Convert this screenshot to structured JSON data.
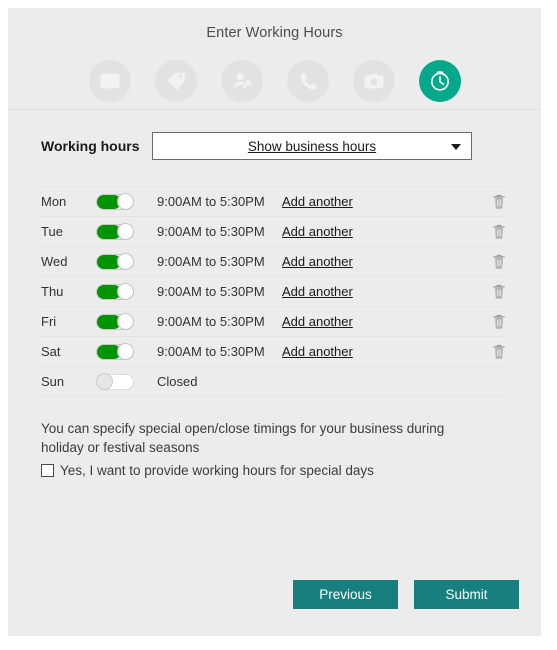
{
  "wizard": {
    "title": "Enter Working Hours",
    "steps": [
      {
        "icon": "id-card-icon",
        "name": "step-business-info",
        "active": false
      },
      {
        "icon": "tag-icon",
        "name": "step-category",
        "active": false
      },
      {
        "icon": "person-add-icon",
        "name": "step-people",
        "active": false
      },
      {
        "icon": "phone-icon",
        "name": "step-contact",
        "active": false
      },
      {
        "icon": "camera-icon",
        "name": "step-photos",
        "active": false
      },
      {
        "icon": "clock-icon",
        "name": "step-working-hours",
        "active": true
      }
    ]
  },
  "working_hours": {
    "label": "Working hours",
    "select_value": "Show business hours",
    "caret": "chevron-down-icon"
  },
  "days": [
    {
      "day": "Mon",
      "enabled": true,
      "toggle_state": "on",
      "hours": "9:00AM to 5:30PM",
      "add_label": "Add another",
      "trash": "trash-icon"
    },
    {
      "day": "Tue",
      "enabled": true,
      "toggle_state": "on",
      "hours": "9:00AM to 5:30PM",
      "add_label": "Add another",
      "trash": "trash-icon"
    },
    {
      "day": "Wed",
      "enabled": true,
      "toggle_state": "on",
      "hours": "9:00AM to 5:30PM",
      "add_label": "Add another",
      "trash": "trash-icon"
    },
    {
      "day": "Thu",
      "enabled": true,
      "toggle_state": "on",
      "hours": "9:00AM to 5:30PM",
      "add_label": "Add another",
      "trash": "trash-icon"
    },
    {
      "day": "Fri",
      "enabled": true,
      "toggle_state": "on",
      "hours": "9:00AM to 5:30PM",
      "add_label": "Add another",
      "trash": "trash-icon"
    },
    {
      "day": "Sat",
      "enabled": true,
      "toggle_state": "on",
      "hours": "9:00AM to 5:30PM",
      "add_label": "Add another",
      "trash": "trash-icon"
    },
    {
      "day": "Sun",
      "enabled": false,
      "toggle_state": "off",
      "hours": "Closed",
      "add_label": "",
      "trash": ""
    }
  ],
  "special_days": {
    "note": "You can specify special open/close timings for your business during holiday or festival seasons",
    "checkbox_label": "Yes, I want to provide working hours for special days",
    "checked": false
  },
  "footer": {
    "previous_label": "Previous",
    "submit_label": "Submit"
  },
  "colors": {
    "accent_active": "#05a88b",
    "button": "#17807e",
    "toggle_on": "#009500",
    "card_bg": "#ececec"
  }
}
